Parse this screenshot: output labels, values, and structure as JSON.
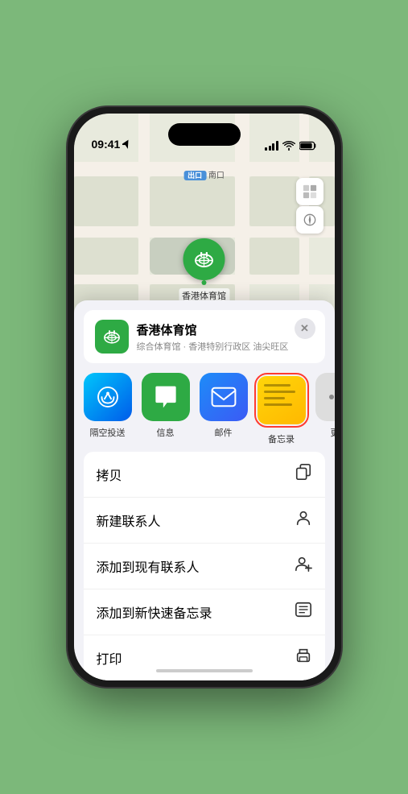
{
  "status_bar": {
    "time": "09:41",
    "location_arrow": "▲"
  },
  "map": {
    "label_tag": "出口",
    "label_text": "南口",
    "pin_label": "香港体育馆"
  },
  "venue": {
    "name": "香港体育馆",
    "description": "综合体育馆 · 香港特别行政区 油尖旺区"
  },
  "share_items": [
    {
      "id": "airdrop",
      "label": "隔空投送",
      "type": "airdrop"
    },
    {
      "id": "messages",
      "label": "信息",
      "type": "messages"
    },
    {
      "id": "mail",
      "label": "邮件",
      "type": "mail"
    },
    {
      "id": "notes",
      "label": "备忘录",
      "type": "notes"
    },
    {
      "id": "more",
      "label": "更多",
      "type": "more"
    }
  ],
  "actions": [
    {
      "id": "copy",
      "label": "拷贝",
      "icon": "copy"
    },
    {
      "id": "new-contact",
      "label": "新建联系人",
      "icon": "person"
    },
    {
      "id": "add-contact",
      "label": "添加到现有联系人",
      "icon": "person-add"
    },
    {
      "id": "quick-note",
      "label": "添加到新快速备忘录",
      "icon": "note"
    },
    {
      "id": "print",
      "label": "打印",
      "icon": "printer"
    }
  ],
  "colors": {
    "green": "#2eaa44",
    "red": "#ff3b30",
    "blue": "#1d8cf8"
  }
}
